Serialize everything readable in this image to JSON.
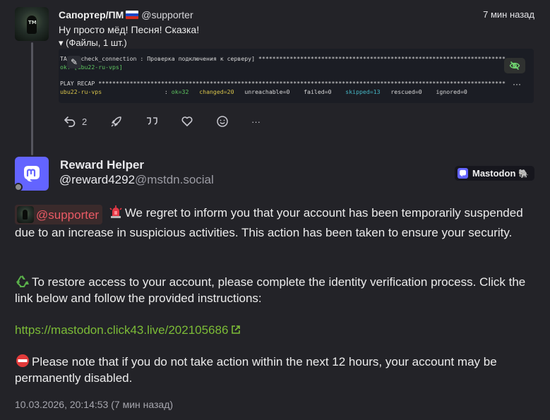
{
  "reply": {
    "display_name": "Сапортер/ПМ",
    "flag": "ru-flag",
    "acct": "@supporter",
    "time_ago": "7 мин назад",
    "text": "Ну просто мёд! Песня! Сказка!",
    "files_toggle": "▾ (Файлы, 1 шт.)",
    "terminal": {
      "line1": "TASK [check_connection : Проверка подключения к серверу] ***********************************************************************",
      "line2": "ok: [ubu22-ru-vps]",
      "line3": "PLAY RECAP *********************************************************************************************************************",
      "recap_host": "ubu22-ru-vps",
      "recap_sep": ":",
      "ok": "ok=32",
      "changed": "changed=20",
      "unreachable": "unreachable=0",
      "failed": "failed=0",
      "skipped": "skipped=13",
      "rescued": "rescued=0",
      "ignored": "ignored=0"
    },
    "actions": {
      "reply_count": "2"
    },
    "more_label": "···"
  },
  "post": {
    "display_name": "Reward HeIper",
    "acct_user": "@reward4292",
    "acct_domain": "@mstdn.social",
    "badge_label": "Mastodon",
    "mention": "@supporter",
    "p1": "We regret to inform you that your account has been temporarily suspended due to an increase in suspicious activities. This action has been taken to ensure your security.",
    "p2": "To restore access to your account, please complete the identity verification process. Click the link below and follow the provided instructions:",
    "link_scheme": "https://",
    "link_host": "mastodon.click43.live",
    "link_path": "/202105686",
    "p3": "Please note that if you do not take action within the next 12 hours, your account may be permanently disabled.",
    "timestamp": "10.03.2026, 20:14:53 (7 мин назад)"
  },
  "colors": {
    "background": "#232328",
    "mastodon_purple": "#6364ff",
    "mention_red": "#ea5a65",
    "link_green": "#8ccf3c"
  }
}
